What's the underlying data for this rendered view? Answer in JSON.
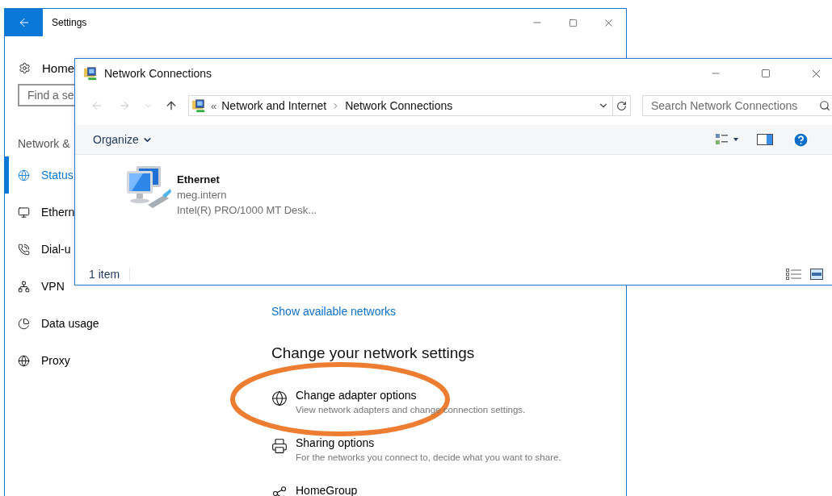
{
  "settings_window": {
    "title": "Settings",
    "sidebar": {
      "home": "Home",
      "search": {
        "placeholder": "Find a se"
      },
      "section": "Network &",
      "items": [
        {
          "label": "Status",
          "kind": "status",
          "selected": true
        },
        {
          "label": "Ethern",
          "kind": "ethernet",
          "selected": false
        },
        {
          "label": "Dial-u",
          "kind": "dialup",
          "selected": false
        },
        {
          "label": "VPN",
          "kind": "vpn",
          "selected": false
        },
        {
          "label": "Data usage",
          "kind": "data",
          "selected": false
        },
        {
          "label": "Proxy",
          "kind": "proxy",
          "selected": false
        }
      ]
    },
    "main": {
      "link": "Show available networks",
      "heading": "Change your network settings",
      "options": [
        {
          "kind": "adapter",
          "title": "Change adapter options",
          "description": "View network adapters and change connection settings."
        },
        {
          "kind": "sharing",
          "title": "Sharing options",
          "description": "For the networks you connect to, decide what you want to share."
        },
        {
          "kind": "homegroup",
          "title": "HomeGroup"
        }
      ]
    }
  },
  "network_connections_window": {
    "title": "Network Connections",
    "address": {
      "overflow_marker": "«",
      "path": [
        "Network and Internet",
        "Network Connections"
      ]
    },
    "search": {
      "placeholder": "Search Network Connections"
    },
    "toolbar": {
      "organize": "Organize"
    },
    "items": [
      {
        "name": "Ethernet",
        "network": "meg.intern",
        "adapter": "Intel(R) PRO/1000 MT Desk..."
      }
    ],
    "status_bar": {
      "count": "1 item"
    }
  }
}
